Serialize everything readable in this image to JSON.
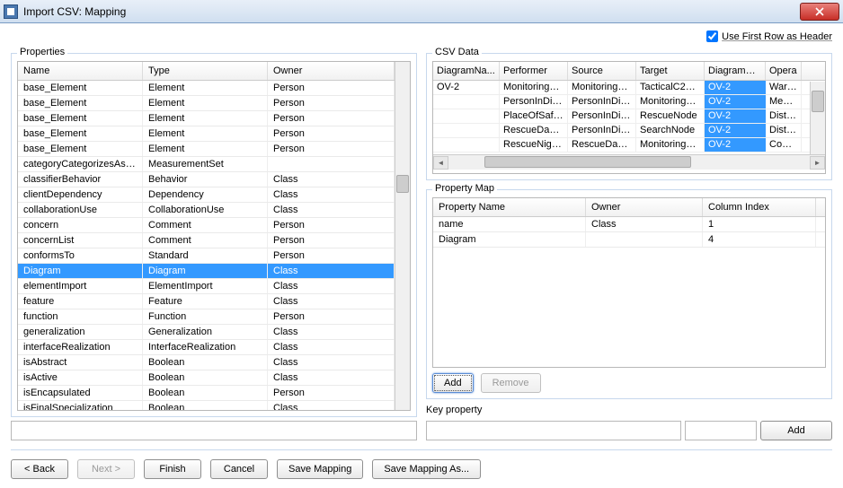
{
  "window": {
    "title": "Import CSV: Mapping"
  },
  "checkbox": {
    "label": "Use First Row as Header",
    "checked": true
  },
  "properties": {
    "label": "Properties",
    "columns": [
      "Name",
      "Type",
      "Owner"
    ],
    "rows": [
      {
        "name": "base_Element",
        "type": "Element",
        "owner": "Person",
        "selected": false
      },
      {
        "name": "base_Element",
        "type": "Element",
        "owner": "Person",
        "selected": false
      },
      {
        "name": "base_Element",
        "type": "Element",
        "owner": "Person",
        "selected": false
      },
      {
        "name": "base_Element",
        "type": "Element",
        "owner": "Person",
        "selected": false
      },
      {
        "name": "base_Element",
        "type": "Element",
        "owner": "Person",
        "selected": false
      },
      {
        "name": "categoryCategorizesAsset",
        "type": "MeasurementSet",
        "owner": "",
        "selected": false
      },
      {
        "name": "classifierBehavior",
        "type": "Behavior",
        "owner": "Class",
        "selected": false
      },
      {
        "name": "clientDependency",
        "type": "Dependency",
        "owner": "Class",
        "selected": false
      },
      {
        "name": "collaborationUse",
        "type": "CollaborationUse",
        "owner": "Class",
        "selected": false
      },
      {
        "name": "concern",
        "type": "Comment",
        "owner": "Person",
        "selected": false
      },
      {
        "name": "concernList",
        "type": "Comment",
        "owner": "Person",
        "selected": false
      },
      {
        "name": "conformsTo",
        "type": "Standard",
        "owner": "Person",
        "selected": false
      },
      {
        "name": "Diagram",
        "type": "Diagram",
        "owner": "Class",
        "selected": true
      },
      {
        "name": "elementImport",
        "type": "ElementImport",
        "owner": "Class",
        "selected": false
      },
      {
        "name": "feature",
        "type": "Feature",
        "owner": "Class",
        "selected": false
      },
      {
        "name": "function",
        "type": "Function",
        "owner": "Person",
        "selected": false
      },
      {
        "name": "generalization",
        "type": "Generalization",
        "owner": "Class",
        "selected": false
      },
      {
        "name": "interfaceRealization",
        "type": "InterfaceRealization",
        "owner": "Class",
        "selected": false
      },
      {
        "name": "isAbstract",
        "type": "Boolean",
        "owner": "Class",
        "selected": false
      },
      {
        "name": "isActive",
        "type": "Boolean",
        "owner": "Class",
        "selected": false
      },
      {
        "name": "isEncapsulated",
        "type": "Boolean",
        "owner": "Person",
        "selected": false
      },
      {
        "name": "isFinalSpecialization",
        "type": "Boolean",
        "owner": "Class",
        "selected": false
      }
    ]
  },
  "csv": {
    "label": "CSV Data",
    "columns": [
      "DiagramNa...",
      "Performer",
      "Source",
      "Target",
      "DiagramO...",
      "Opera"
    ],
    "rows": [
      [
        "OV-2",
        "MonitoringN...",
        "MonitoringN...",
        "TacticalC2N...",
        "OV-2",
        "Warnin"
      ],
      [
        "",
        "PersonInDis...",
        "PersonInDis...",
        "MonitoringN...",
        "OV-2",
        "Medica"
      ],
      [
        "",
        "PlaceOfSafety",
        "PersonInDis...",
        "RescueNode",
        "OV-2",
        "Distres"
      ],
      [
        "",
        "RescueDayS...",
        "PersonInDis...",
        "SearchNode",
        "OV-2",
        "Distres"
      ],
      [
        "",
        "RescueNight...",
        "RescueDayS...",
        "MonitoringN...",
        "OV-2",
        "Contro"
      ]
    ],
    "highlightCol": 4
  },
  "pmap": {
    "label": "Property Map",
    "columns": [
      "Property Name",
      "Owner",
      "Column Index"
    ],
    "rows": [
      {
        "name": "name",
        "owner": "Class",
        "index": "1"
      },
      {
        "name": "Diagram",
        "owner": "",
        "index": "4"
      }
    ],
    "buttons": {
      "add": "Add",
      "remove": "Remove"
    }
  },
  "key": {
    "label": "Key property",
    "addLabel": "Add",
    "value1": "",
    "value2": ""
  },
  "footer": {
    "back": "< Back",
    "next": "Next >",
    "finish": "Finish",
    "cancel": "Cancel",
    "saveMapping": "Save Mapping",
    "saveMappingAs": "Save Mapping As..."
  }
}
